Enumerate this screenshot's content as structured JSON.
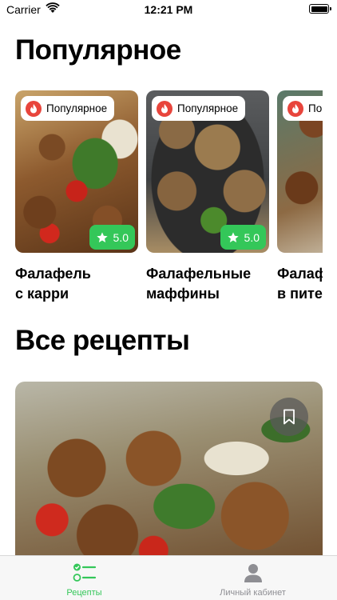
{
  "status_bar": {
    "carrier": "Carrier",
    "time": "12:21 PM"
  },
  "popular_section": {
    "title": "Популярное",
    "cards": [
      {
        "badge": "Популярное",
        "rating": "5.0",
        "name_line1": "Фалафель",
        "name_line2": "с карри"
      },
      {
        "badge": "Популярное",
        "rating": "5.0",
        "name_line1": "Фалафельные",
        "name_line2": "маффины"
      },
      {
        "badge": "По",
        "rating": "",
        "name_line1": "Фалафе",
        "name_line2": "в пите"
      }
    ]
  },
  "all_recipes_section": {
    "title": "Все рецепты"
  },
  "tab_bar": {
    "items": [
      {
        "label": "Рецепты",
        "icon": "checklist-icon",
        "active": true
      },
      {
        "label": "Личный кабинет",
        "icon": "person-icon",
        "active": false
      }
    ]
  },
  "colors": {
    "accent": "#34c759",
    "flame": "#e8453c",
    "inactive": "#8e8e93"
  }
}
